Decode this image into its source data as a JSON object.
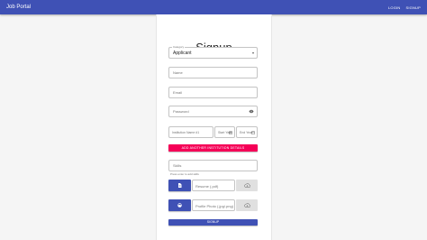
{
  "appbar": {
    "brand": "Job Portal",
    "nav": {
      "login": "LOGIN",
      "signup": "SIGNUP"
    }
  },
  "form": {
    "title": "Signup",
    "category": {
      "legend": "Category",
      "value": "Applicant"
    },
    "name": {
      "placeholder": "Name"
    },
    "email": {
      "placeholder": "Email"
    },
    "password": {
      "placeholder": "Password"
    },
    "institution": {
      "name_placeholder": "Institution Name #1",
      "start_placeholder": "Start Year",
      "end_placeholder": "End Year"
    },
    "add_institution_label": "ADD ANOTHER INSTITUTION DETAILS",
    "skills": {
      "placeholder": "Skills",
      "helper": "Press enter to add skills"
    },
    "resume": {
      "placeholder": "Resume (.pdf)"
    },
    "photo": {
      "placeholder": "Profile Photo (.jpg/.png)"
    },
    "submit_label": "SIGNUP"
  },
  "colors": {
    "primary": "#3f51b5",
    "secondary": "#f50057"
  },
  "icons": {
    "eye": "visibility-icon",
    "calendar": "calendar-icon",
    "file": "description-icon",
    "face": "face-icon",
    "cloud": "cloud-upload-icon"
  }
}
